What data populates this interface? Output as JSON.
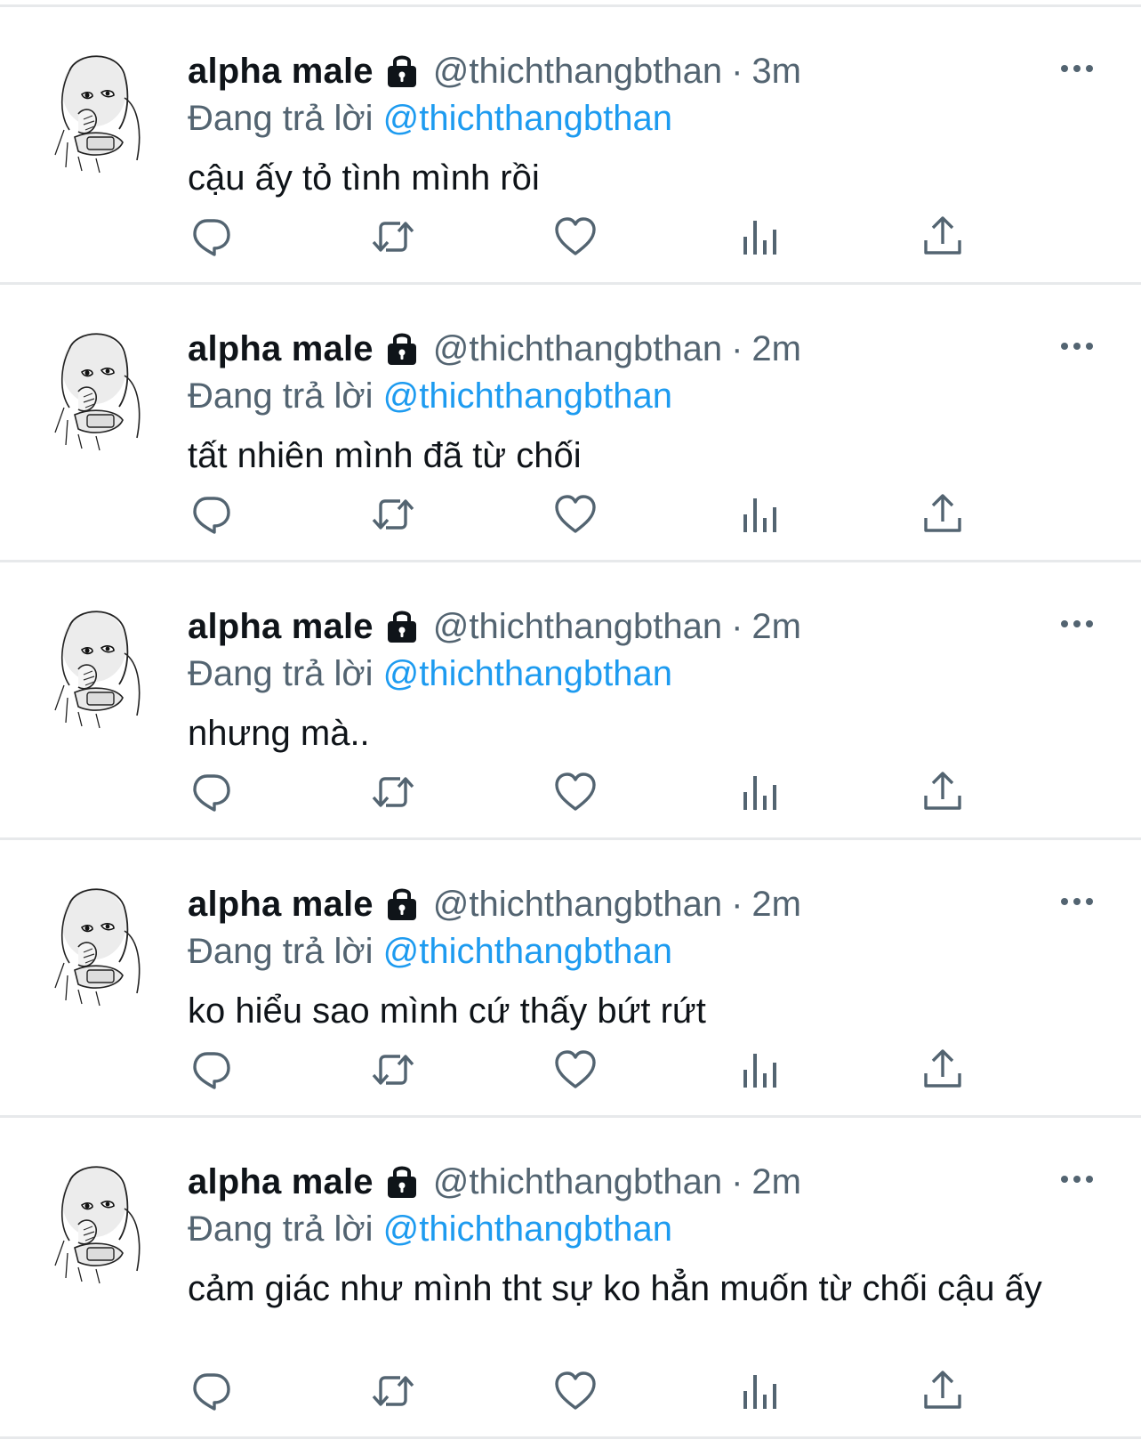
{
  "tweets": [
    {
      "display_name": "alpha male",
      "handle": "@thichthangbthan",
      "separator": "·",
      "time": "3m",
      "reply_prefix": "Đang trả lời",
      "reply_to": "@thichthangbthan",
      "text": "cậu ấy tỏ tình mình rồi"
    },
    {
      "display_name": "alpha male",
      "handle": "@thichthangbthan",
      "separator": "·",
      "time": "2m",
      "reply_prefix": "Đang trả lời",
      "reply_to": "@thichthangbthan",
      "text": "tất nhiên mình đã từ chối"
    },
    {
      "display_name": "alpha male",
      "handle": "@thichthangbthan",
      "separator": "·",
      "time": "2m",
      "reply_prefix": "Đang trả lời",
      "reply_to": "@thichthangbthan",
      "text": "nhưng mà.."
    },
    {
      "display_name": "alpha male",
      "handle": "@thichthangbthan",
      "separator": "·",
      "time": "2m",
      "reply_prefix": "Đang trả lời",
      "reply_to": "@thichthangbthan",
      "text": "ko hiểu sao mình cứ thấy bứt rứt"
    },
    {
      "display_name": "alpha male",
      "handle": "@thichthangbthan",
      "separator": "·",
      "time": "2m",
      "reply_prefix": "Đang trả lời",
      "reply_to": "@thichthangbthan",
      "text": "cảm giác như mình tht sự ko hẳn muốn từ chối cậu ấy"
    }
  ],
  "icons": {
    "protected": "lock-icon",
    "more": "more-icon",
    "reply": "reply-icon",
    "retweet": "retweet-icon",
    "like": "heart-icon",
    "views": "views-icon",
    "share": "share-icon"
  },
  "colors": {
    "text_primary": "#0f1419",
    "text_secondary": "#536471",
    "mention": "#1d9bf0",
    "divider": "#e7e9eb"
  }
}
